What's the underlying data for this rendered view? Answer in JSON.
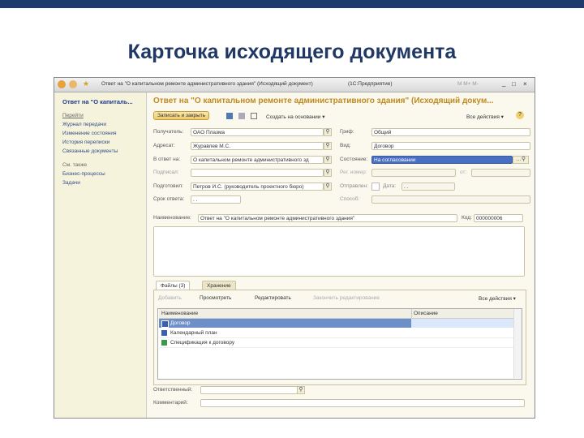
{
  "slide": {
    "title": "Карточка исходящего документа"
  },
  "window": {
    "title": "Ответ на \"О капитальном ремонте административного здания\" (Исходящий документ)",
    "app": "(1С:Предприятие)",
    "controls": [
      "M",
      "M+",
      "M-"
    ]
  },
  "sidebar": {
    "header": "Ответ на \"О капиталь...",
    "goto_label": "Перейти",
    "goto_items": [
      "Журнал передачи",
      "Изменение состояния",
      "История переписки",
      "Связанные документы"
    ],
    "see_also_label": "См. также",
    "see_also_items": [
      "Бизнес-процессы",
      "Задачи"
    ]
  },
  "form": {
    "heading": "Ответ на \"О капитальном ремонте административного здания\" (Исходящий докум...",
    "save_close": "Записать и закрыть",
    "create_based": "Создать на основании ▾",
    "all_actions": "Все действия ▾",
    "left_fields": [
      {
        "label": "Получатель:",
        "value": "ОАО Плазма"
      },
      {
        "label": "Адресат:",
        "value": "Журавлев М.С."
      },
      {
        "label": "В ответ на:",
        "value": "О капитальном ремонте административного зд"
      },
      {
        "label": "Подписал:",
        "value": ""
      },
      {
        "label": "Подготовил:",
        "value": "Петров И.С. (руководитель проектного бюро)"
      },
      {
        "label": "Срок ответа:",
        "value": ". ."
      }
    ],
    "right_fields": {
      "type_label": "Гриф:",
      "type_value": "Общий",
      "kind_label": "Вид:",
      "kind_value": "Договор",
      "state_label": "Состояние:",
      "state_value": "На согласовании",
      "reg_label": "Рег. номер:",
      "reg_value": "",
      "from_label": "от:",
      "sent_label": "Отправлен:",
      "date_label": "Дата:",
      "date_value": ". .",
      "method_label": "Способ:",
      "method_value": ""
    },
    "name_label": "Наименование:",
    "name_value": "Ответ на \"О капитальном ремонте административного здания\"",
    "code_label": "Код:",
    "code_value": "000000006",
    "tabs": [
      "Файлы (3)",
      "Хранение"
    ],
    "file_toolbar": [
      "Добавить",
      "Просмотреть",
      "Редактировать",
      "Закончить редактирование"
    ],
    "file_all_actions": "Все действия ▾",
    "table": {
      "columns": [
        "Наименование",
        "Описание"
      ],
      "rows": [
        {
          "name": "Договор",
          "desc": ""
        },
        {
          "name": "Календарный план",
          "desc": ""
        },
        {
          "name": "Спецификация к договору",
          "desc": ""
        }
      ]
    },
    "responsible_label": "Ответственный:",
    "responsible_value": "",
    "comment_label": "Комментарий:",
    "comment_value": ""
  }
}
